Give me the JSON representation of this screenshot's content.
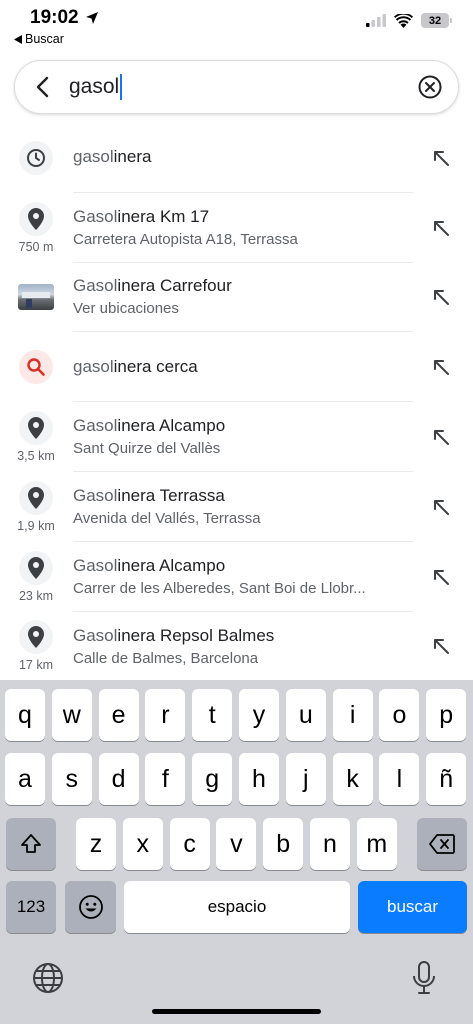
{
  "status": {
    "time": "19:02",
    "back_app": "Buscar",
    "battery": "32"
  },
  "search": {
    "query": "gasol"
  },
  "suggestions": [
    {
      "icon": "history-icon",
      "match": "gasol",
      "rest": "inera",
      "subtitle": "",
      "distance": ""
    },
    {
      "icon": "place-pin-icon",
      "match": "Gasol",
      "rest": "inera Km 17",
      "subtitle": "Carretera Autopista A18, Terrassa",
      "distance": "750 m"
    },
    {
      "icon": "photo-thumbnail",
      "match": "Gasol",
      "rest": "inera Carrefour",
      "subtitle": "Ver ubicaciones",
      "distance": ""
    },
    {
      "icon": "search-icon",
      "match": "gasol",
      "rest": "inera cerca",
      "subtitle": "",
      "distance": ""
    },
    {
      "icon": "place-pin-icon",
      "match": "Gasol",
      "rest": "inera Alcampo",
      "subtitle": "Sant Quirze del Vallès",
      "distance": "3,5 km"
    },
    {
      "icon": "place-pin-icon",
      "match": "Gasol",
      "rest": "inera Terrassa",
      "subtitle": "Avenida del Vallés, Terrassa",
      "distance": "1,9 km"
    },
    {
      "icon": "place-pin-icon",
      "match": "Gasol",
      "rest": "inera Alcampo",
      "subtitle": "Carrer de les Alberedes, Sant Boi de Llobr...",
      "distance": "23 km"
    },
    {
      "icon": "place-pin-icon",
      "match": "Gasol",
      "rest": "inera Repsol Balmes",
      "subtitle": "Calle de Balmes, Barcelona",
      "distance": "17 km"
    }
  ],
  "keyboard": {
    "row1": [
      "q",
      "w",
      "e",
      "r",
      "t",
      "y",
      "u",
      "i",
      "o",
      "p"
    ],
    "row2": [
      "a",
      "s",
      "d",
      "f",
      "g",
      "h",
      "j",
      "k",
      "l",
      "ñ"
    ],
    "row3": [
      "z",
      "x",
      "c",
      "v",
      "b",
      "n",
      "m"
    ],
    "numbers_label": "123",
    "space_label": "espacio",
    "return_label": "buscar"
  },
  "colors": {
    "accent": "#1a73e8",
    "return_key": "#0a7cff",
    "keyboard_bg": "#d1d3d9"
  }
}
